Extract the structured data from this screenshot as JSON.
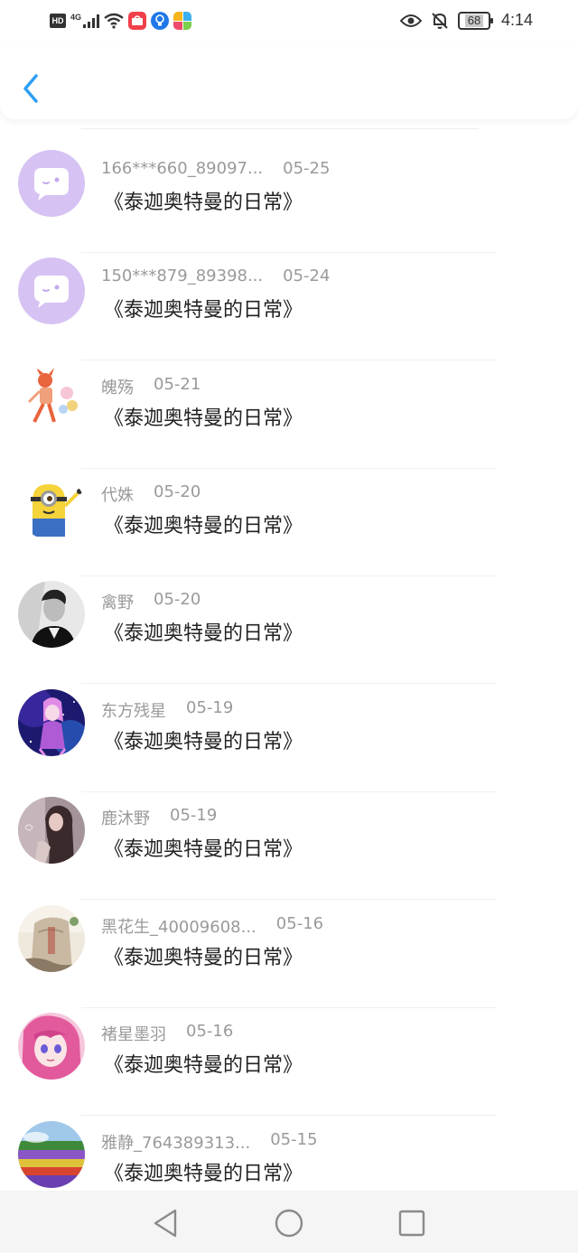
{
  "status_bar": {
    "hd": "HD",
    "network": "4G",
    "battery": "68",
    "time": "4:14"
  },
  "header": {
    "back_icon": "chevron-left-icon"
  },
  "items": [
    {
      "user": "166***660_89097...",
      "date": "05-25",
      "title": "《泰迦奥特曼的日常》",
      "avatar": "default-chat-avatar"
    },
    {
      "user": "150***879_89398...",
      "date": "05-24",
      "title": "《泰迦奥特曼的日常》",
      "avatar": "default-chat-avatar"
    },
    {
      "user": "魄殇",
      "date": "05-21",
      "title": "《泰迦奥特曼的日常》",
      "avatar": "robot-character-avatar"
    },
    {
      "user": "代姝",
      "date": "05-20",
      "title": "《泰迦奥特曼的日常》",
      "avatar": "minion-avatar"
    },
    {
      "user": "禽野",
      "date": "05-20",
      "title": "《泰迦奥特曼的日常》",
      "avatar": "man-portrait-avatar"
    },
    {
      "user": "东方残星",
      "date": "05-19",
      "title": "《泰迦奥特曼的日常》",
      "avatar": "anime-galaxy-avatar"
    },
    {
      "user": "鹿沐野",
      "date": "05-19",
      "title": "《泰迦奥特曼的日常》",
      "avatar": "girl-portrait-avatar"
    },
    {
      "user": "黑花生_40009608...",
      "date": "05-16",
      "title": "《泰迦奥特曼的日常》",
      "avatar": "stone-sign-avatar"
    },
    {
      "user": "褚星墨羽",
      "date": "05-16",
      "title": "《泰迦奥特曼的日常》",
      "avatar": "anime-girl-avatar"
    },
    {
      "user": "雅静_764389313...",
      "date": "05-15",
      "title": "《泰迦奥特曼的日常》",
      "avatar": "flower-field-avatar"
    }
  ],
  "colors": {
    "accent": "#2f9ff3",
    "username": "#9a9a9a",
    "title": "#222222",
    "default_avatar_bg": "#d6c2f3"
  }
}
